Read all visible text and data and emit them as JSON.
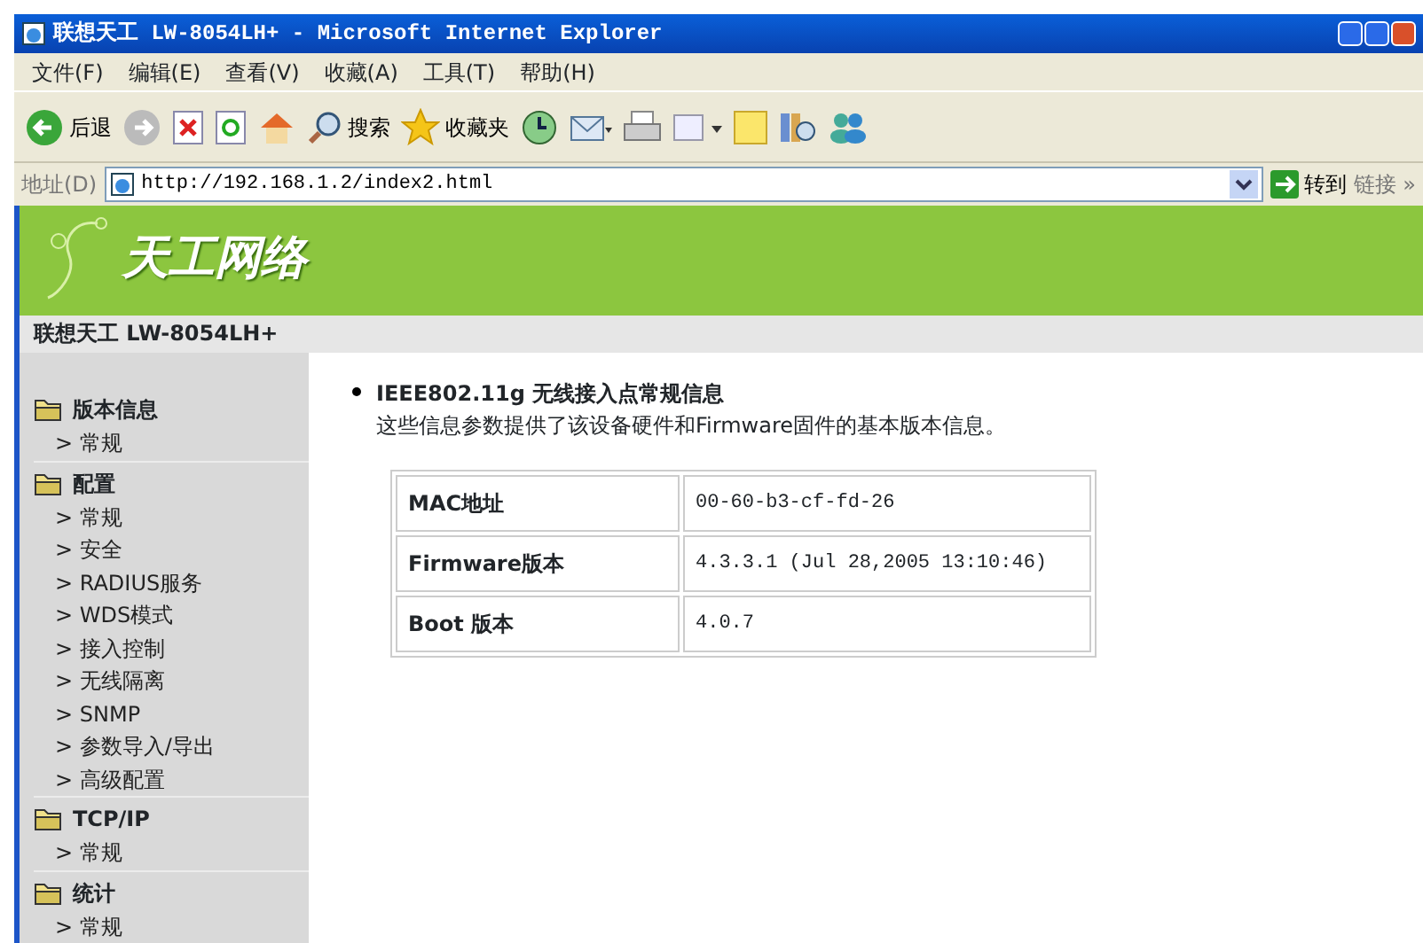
{
  "window": {
    "title": "联想天工 LW-8054LH+ - Microsoft Internet Explorer"
  },
  "menu": [
    "文件(F)",
    "编辑(E)",
    "查看(V)",
    "收藏(A)",
    "工具(T)",
    "帮助(H)"
  ],
  "toolbar": {
    "back": "后退",
    "search": "搜索",
    "favorites": "收藏夹"
  },
  "address": {
    "label": "地址(D)",
    "url": "http://192.168.1.2/index2.html",
    "go": "转到",
    "links": "链接 »"
  },
  "header": {
    "logo": "天工网络",
    "product": "联想天工  LW-8054LH+"
  },
  "sidebar": [
    {
      "label": "版本信息",
      "children": [
        {
          "label": "> 常规"
        }
      ]
    },
    {
      "label": "配置",
      "children": [
        {
          "label": "> 常规"
        },
        {
          "label": "> 安全"
        },
        {
          "label": "> RADIUS服务"
        },
        {
          "label": "> WDS模式"
        },
        {
          "label": "> 接入控制"
        },
        {
          "label": "> 无线隔离"
        },
        {
          "label": "> SNMP"
        },
        {
          "label": "> 参数导入/导出"
        },
        {
          "label": "> 高级配置"
        }
      ]
    },
    {
      "label": "TCP/IP",
      "children": [
        {
          "label": "> 常规"
        }
      ]
    },
    {
      "label": "统计",
      "children": [
        {
          "label": "> 常规"
        }
      ]
    }
  ],
  "content": {
    "heading": "IEEE802.11g 无线接入点常规信息",
    "description": "这些信息参数提供了该设备硬件和Firmware固件的基本版本信息。",
    "rows": [
      {
        "label": "MAC地址",
        "value": "00-60-b3-cf-fd-26"
      },
      {
        "label": "Firmware版本",
        "value": "4.3.3.1 (Jul 28,2005 13:10:46)"
      },
      {
        "label": "Boot 版本",
        "value": "4.0.7"
      }
    ]
  }
}
